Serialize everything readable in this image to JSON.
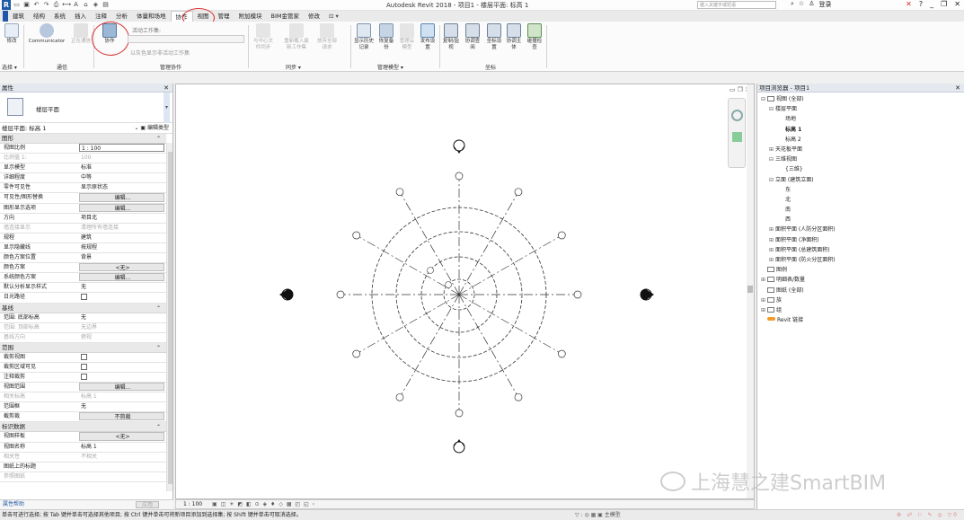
{
  "titlebar": {
    "logo": "R",
    "title": "Autodesk Revit 2018 -   项目1 - 楼层平面: 标高 1",
    "search_placeholder": "键入关键字或短语",
    "login": "登录",
    "help": "?"
  },
  "tabs": [
    "建筑",
    "结构",
    "系统",
    "插入",
    "注释",
    "分析",
    "体量和场地",
    "协作",
    "视图",
    "管理",
    "附加模块",
    "BIM金管家",
    "修改"
  ],
  "active_tab": "协作",
  "ribbon": {
    "modify": "修改",
    "communicator": "Communicator",
    "chat": "正在通信",
    "collaborate": "协作",
    "active_workset_label": "活动工作集:",
    "gray_inactive": "以灰色显示非活动工作集",
    "sync_center": "与中心文件同步",
    "reload_latest": "重新载入最新工作集",
    "relinquish": "放弃全部请求",
    "show_history": "显示历史记录",
    "restore_backup": "恢复备份",
    "manage_cloud": "管理云模型",
    "publish": "发布设置",
    "copy_monitor": "复制/监视",
    "coord_review": "协调查阅",
    "coord_settings": "坐标设置",
    "coord_host": "协调主体",
    "interference": "碰撞检查",
    "panel_select": "选择 ▾",
    "panel_comm": "通信",
    "panel_manage": "管理协作",
    "panel_sync": "同步 ▾",
    "panel_model": "管理模型 ▾",
    "panel_coord": "坐标"
  },
  "properties": {
    "header": "属性",
    "type_name": "楼层平面",
    "instance": "楼层平面: 标高 1",
    "edit_type": "编辑类型",
    "groups": [
      {
        "name": "图形",
        "rows": [
          {
            "k": "视图比例",
            "v": "1 : 100",
            "style": "input"
          },
          {
            "k": "比例值 1:",
            "v": "100",
            "style": "dim"
          },
          {
            "k": "显示模型",
            "v": "标准"
          },
          {
            "k": "详细程度",
            "v": "中等"
          },
          {
            "k": "零件可见性",
            "v": "显示原状态"
          },
          {
            "k": "可见性/图形替换",
            "v": "编辑...",
            "style": "btn"
          },
          {
            "k": "图形显示选项",
            "v": "编辑...",
            "style": "btn"
          },
          {
            "k": "方向",
            "v": "项目北"
          },
          {
            "k": "墙连接显示",
            "v": "清理所有墙连接",
            "style": "dim"
          },
          {
            "k": "规程",
            "v": "建筑"
          },
          {
            "k": "显示隐藏线",
            "v": "按规程"
          },
          {
            "k": "颜色方案位置",
            "v": "背景"
          },
          {
            "k": "颜色方案",
            "v": "<无>",
            "style": "btn"
          },
          {
            "k": "系统颜色方案",
            "v": "编辑...",
            "style": "btn"
          },
          {
            "k": "默认分析显示样式",
            "v": "无"
          },
          {
            "k": "日光路径",
            "v": "",
            "style": "chk"
          }
        ]
      },
      {
        "name": "基线",
        "rows": [
          {
            "k": "范围: 底部标高",
            "v": "无"
          },
          {
            "k": "范围: 顶部标高",
            "v": "无边界",
            "style": "dim"
          },
          {
            "k": "基线方向",
            "v": "俯视",
            "style": "dim"
          }
        ]
      },
      {
        "name": "范围",
        "rows": [
          {
            "k": "裁剪视图",
            "v": "",
            "style": "chk"
          },
          {
            "k": "裁剪区域可见",
            "v": "",
            "style": "chk"
          },
          {
            "k": "注释裁剪",
            "v": "",
            "style": "chk"
          },
          {
            "k": "视图范围",
            "v": "编辑...",
            "style": "btn"
          },
          {
            "k": "相关标高",
            "v": "标高 1",
            "style": "dim"
          },
          {
            "k": "范围框",
            "v": "无"
          },
          {
            "k": "截剪裁",
            "v": "不剪裁",
            "style": "btn"
          }
        ]
      },
      {
        "name": "标识数据",
        "rows": [
          {
            "k": "视图样板",
            "v": "<无>",
            "style": "btn"
          },
          {
            "k": "视图名称",
            "v": "标高 1"
          },
          {
            "k": "相关性",
            "v": "不相关",
            "style": "dim"
          },
          {
            "k": "图纸上的标题",
            "v": ""
          },
          {
            "k": "参照图纸",
            "v": "",
            "style": "dim"
          }
        ]
      }
    ],
    "help_link": "属性帮助",
    "apply": "应用"
  },
  "view_bar": {
    "scale": "1 : 100"
  },
  "browser": {
    "header": "项目浏览器 - 项目1",
    "tree": [
      {
        "label": "视图 (全部)",
        "level": 0,
        "toggle": "⊟",
        "icon": true
      },
      {
        "label": "楼层平面",
        "level": 1,
        "toggle": "⊟"
      },
      {
        "label": "场地",
        "level": 3
      },
      {
        "label": "标高 1",
        "level": 3,
        "bold": true
      },
      {
        "label": "标高 2",
        "level": 3
      },
      {
        "label": "天花板平面",
        "level": 1,
        "toggle": "⊞"
      },
      {
        "label": "三维视图",
        "level": 1,
        "toggle": "⊟"
      },
      {
        "label": "{三维}",
        "level": 3
      },
      {
        "label": "立面 (建筑立面)",
        "level": 1,
        "toggle": "⊟"
      },
      {
        "label": "东",
        "level": 3
      },
      {
        "label": "北",
        "level": 3
      },
      {
        "label": "南",
        "level": 3
      },
      {
        "label": "西",
        "level": 3
      },
      {
        "label": "面积平面 (人防分区面积)",
        "level": 1,
        "toggle": "⊞"
      },
      {
        "label": "面积平面 (净面积)",
        "level": 1,
        "toggle": "⊞"
      },
      {
        "label": "面积平面 (总建筑面积)",
        "level": 1,
        "toggle": "⊞"
      },
      {
        "label": "面积平面 (防火分区面积)",
        "level": 1,
        "toggle": "⊞"
      },
      {
        "label": "图例",
        "level": 0,
        "icon": true
      },
      {
        "label": "明细表/数量",
        "level": 0,
        "toggle": "⊞",
        "icon": true
      },
      {
        "label": "图纸 (全部)",
        "level": 0,
        "icon": true
      },
      {
        "label": "族",
        "level": 0,
        "toggle": "⊞",
        "icon": true
      },
      {
        "label": "组",
        "level": 0,
        "toggle": "⊞",
        "icon": true
      },
      {
        "label": "Revit 链接",
        "level": 0,
        "link": true
      }
    ]
  },
  "statusbar": {
    "message": "单击可进行选择; 按 Tab 键并单击可选择其他项目; 按 Ctrl 键并单击可将新项目添加到选择集; 按 Shift 键并单击可取消选择。",
    "model": "主模型"
  },
  "watermark": "上海慧之建SmartBIM"
}
